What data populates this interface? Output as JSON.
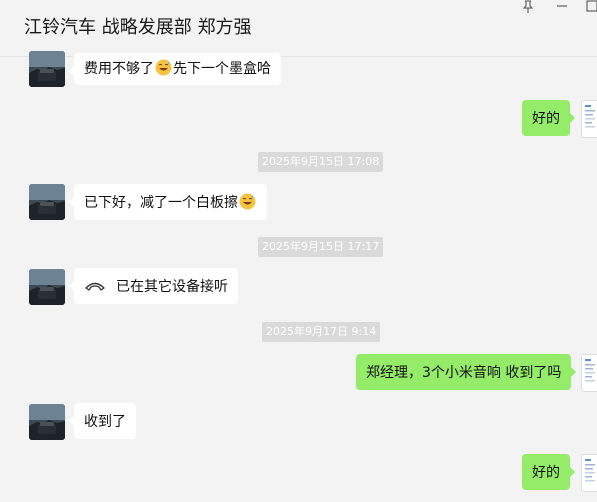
{
  "header": {
    "title": "江铃汽车 战略发展部 郑方强",
    "pin_icon": "pin-icon",
    "minimize_icon": "minimize-icon",
    "maximize_icon": "maximize-icon"
  },
  "messages": [
    {
      "side": "left",
      "text_before": "费用不够了",
      "emoji": "grin-sweat-emoji",
      "text_after": "先下一个墨盒哈"
    },
    {
      "side": "right",
      "text": "好的"
    },
    {
      "type": "time",
      "text": "2025年9月15日 17:08"
    },
    {
      "side": "left",
      "text_before": "已下好，减了一个白板擦",
      "emoji": "grin-sweat-emoji"
    },
    {
      "type": "time",
      "text": "2025年9月15日 17:17"
    },
    {
      "side": "left",
      "call_icon": "phone-hangup-icon",
      "text": "已在其它设备接听"
    },
    {
      "type": "time",
      "text": "2025年9月17日 9:14"
    },
    {
      "side": "right",
      "text": "郑经理，3个小米音响 收到了吗"
    },
    {
      "side": "left",
      "text": "收到了"
    },
    {
      "side": "right",
      "text": "好的"
    }
  ],
  "colors": {
    "background": "#f3f3f3",
    "bubble_self": "#95ec69",
    "bubble_other": "#ffffff",
    "timestamp_bg": "#dadada"
  }
}
